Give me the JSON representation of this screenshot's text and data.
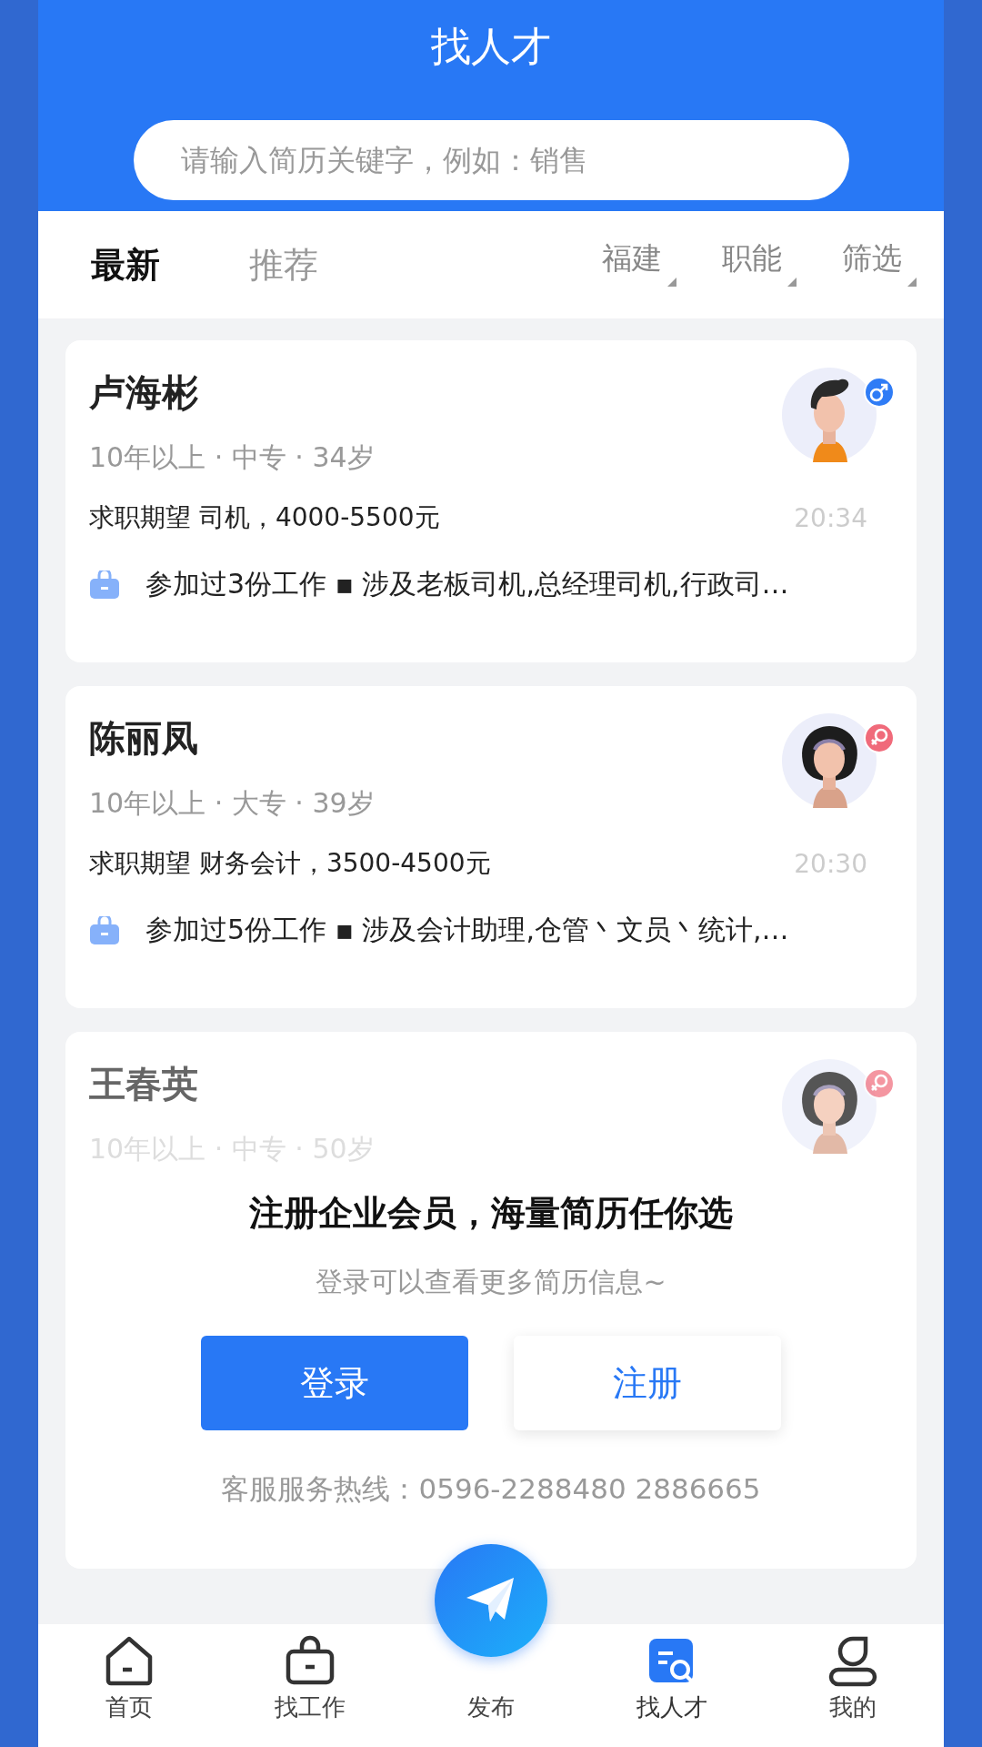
{
  "header": {
    "title": "找人才"
  },
  "search": {
    "placeholder": "请输入简历关键字，例如：销售"
  },
  "tabs": [
    {
      "label": "最新",
      "selected": true
    },
    {
      "label": "推荐",
      "selected": false
    }
  ],
  "filters": [
    {
      "label": "福建"
    },
    {
      "label": "职能"
    },
    {
      "label": "筛选"
    }
  ],
  "candidates": [
    {
      "name": "卢海彬",
      "meta": "10年以上 · 中专 · 34岁",
      "expectation": "求职期望 司机，4000-5500元",
      "time": "20:34",
      "experience": "参加过3份工作 ▪ 涉及老板司机,总经理司机,行政司…",
      "kind": "male",
      "faded": false
    },
    {
      "name": "陈丽凤",
      "meta": "10年以上 · 大专 · 39岁",
      "expectation": "求职期望 财务会计，3500-4500元",
      "time": "20:30",
      "experience": "参加过5份工作 ▪ 涉及会计助理,仓管丶文员丶统计,…",
      "kind": "female",
      "faded": false
    },
    {
      "name": "王春英",
      "meta": "10年以上 · 中专 · 50岁",
      "kind": "female",
      "faded": true
    }
  ],
  "prompt": {
    "title": "注册企业会员，海量简历任你选",
    "subtitle": "登录可以查看更多简历信息~",
    "login": "登录",
    "register": "注册",
    "hotline": "客服服务热线：0596-2288480 2886665"
  },
  "nav": [
    {
      "label": "首页",
      "kind": "home",
      "selected": false
    },
    {
      "label": "找工作",
      "kind": "jobs",
      "selected": false
    },
    {
      "label": "发布",
      "kind": "publish",
      "selected": false
    },
    {
      "label": "找人才",
      "kind": "talent",
      "selected": true
    },
    {
      "label": "我的",
      "kind": "me",
      "selected": false
    }
  ]
}
